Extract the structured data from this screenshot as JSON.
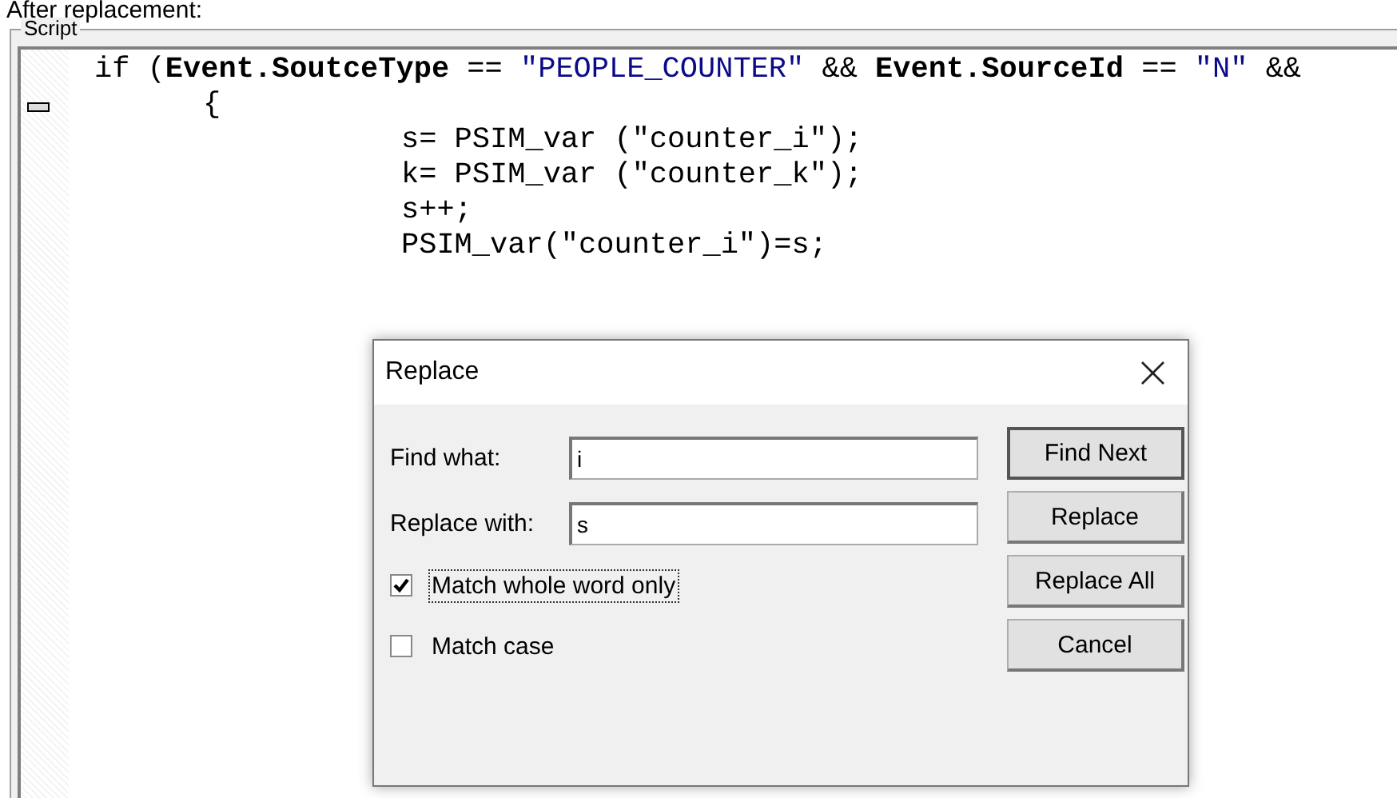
{
  "caption": "After replacement:",
  "script_panel": {
    "title": "Script",
    "lines": [
      {
        "kind": "condition",
        "fold": false,
        "tokens": [
          {
            "kind": "plain",
            "text": "if ("
          },
          {
            "kind": "bold",
            "text": "Event.SoutceType"
          },
          {
            "kind": "plain",
            "text": " == "
          },
          {
            "kind": "string",
            "text": "\"PEOPLE_COUNTER\""
          },
          {
            "kind": "plain",
            "text": " && "
          },
          {
            "kind": "bold",
            "text": "Event.SourceId"
          },
          {
            "kind": "plain",
            "text": " == "
          },
          {
            "kind": "string",
            "text": "\"N\""
          },
          {
            "kind": "plain",
            "text": " &&"
          }
        ]
      },
      {
        "kind": "brace",
        "fold": true,
        "tokens": [
          {
            "kind": "plain",
            "text": "{"
          }
        ]
      },
      {
        "kind": "statement",
        "fold": false,
        "tokens": [
          {
            "kind": "plain",
            "text": "s= PSIM_var (\"counter_i\");"
          }
        ]
      },
      {
        "kind": "statement",
        "fold": false,
        "tokens": [
          {
            "kind": "plain",
            "text": "k= PSIM_var (\"counter_k\");"
          }
        ]
      },
      {
        "kind": "statement",
        "fold": false,
        "tokens": [
          {
            "kind": "plain",
            "text": "s++;"
          }
        ]
      },
      {
        "kind": "statement",
        "fold": false,
        "tokens": [
          {
            "kind": "plain",
            "text": "PSIM_var(\"counter_i\")=s;"
          }
        ]
      }
    ]
  },
  "dialog": {
    "title": "Replace",
    "close": "×",
    "fields": [
      {
        "label": "Find what:",
        "value": "i"
      },
      {
        "label": "Replace with:",
        "value": "s"
      }
    ],
    "options": [
      {
        "label": "Match whole word only",
        "checked": true,
        "focused": true
      },
      {
        "label": "Match case",
        "checked": false,
        "focused": false
      }
    ],
    "buttons": [
      {
        "label": "Find Next",
        "default": true
      },
      {
        "label": "Replace",
        "default": false
      },
      {
        "label": "Replace All",
        "default": false
      },
      {
        "label": "Cancel",
        "default": false
      }
    ]
  }
}
